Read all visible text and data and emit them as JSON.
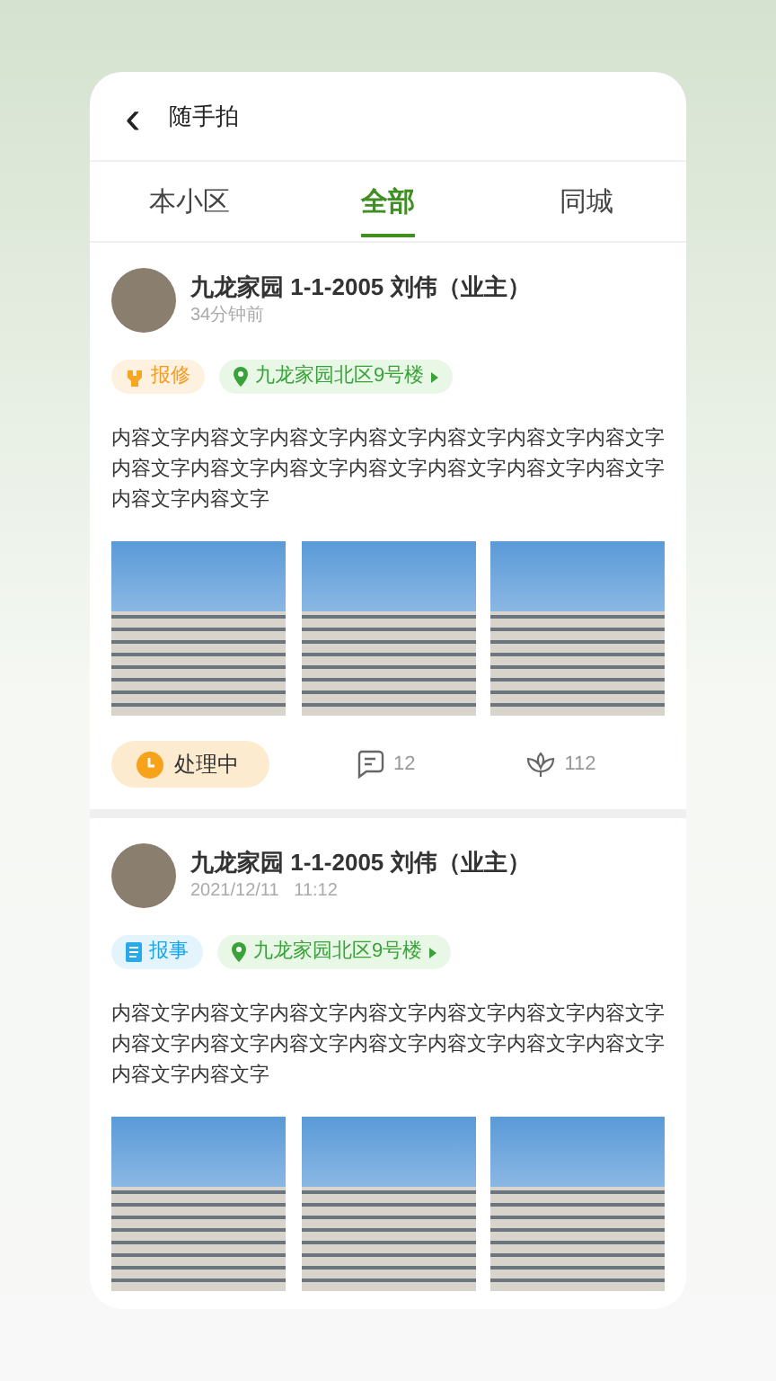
{
  "header": {
    "back": "‹",
    "title": "随手拍"
  },
  "tabs": [
    {
      "label": "本小区",
      "selected": false
    },
    {
      "label": "全部",
      "selected": true
    },
    {
      "label": "同城",
      "selected": false
    }
  ],
  "posts": [
    {
      "author": "九龙家园 1-1-2005 刘伟（业主）",
      "time": "34分钟前",
      "category": {
        "kind": "repair",
        "label": "报修"
      },
      "location": "九龙家园北区9号楼",
      "content": "内容文字内容文字内容文字内容文字内容文字内容文字内容文字内容文字内容文字内容文字内容文字内容文字内容文字内容文字内容文字内容文字",
      "status": "处理中",
      "comments": "12",
      "likes": "112"
    },
    {
      "author": "九龙家园 1-1-2005 刘伟（业主）",
      "time": "2021/12/11   11:12",
      "category": {
        "kind": "report",
        "label": "报事"
      },
      "location": "九龙家园北区9号楼",
      "content": "内容文字内容文字内容文字内容文字内容文字内容文字内容文字内容文字内容文字内容文字内容文字内容文字内容文字内容文字内容文字内容文字"
    }
  ]
}
